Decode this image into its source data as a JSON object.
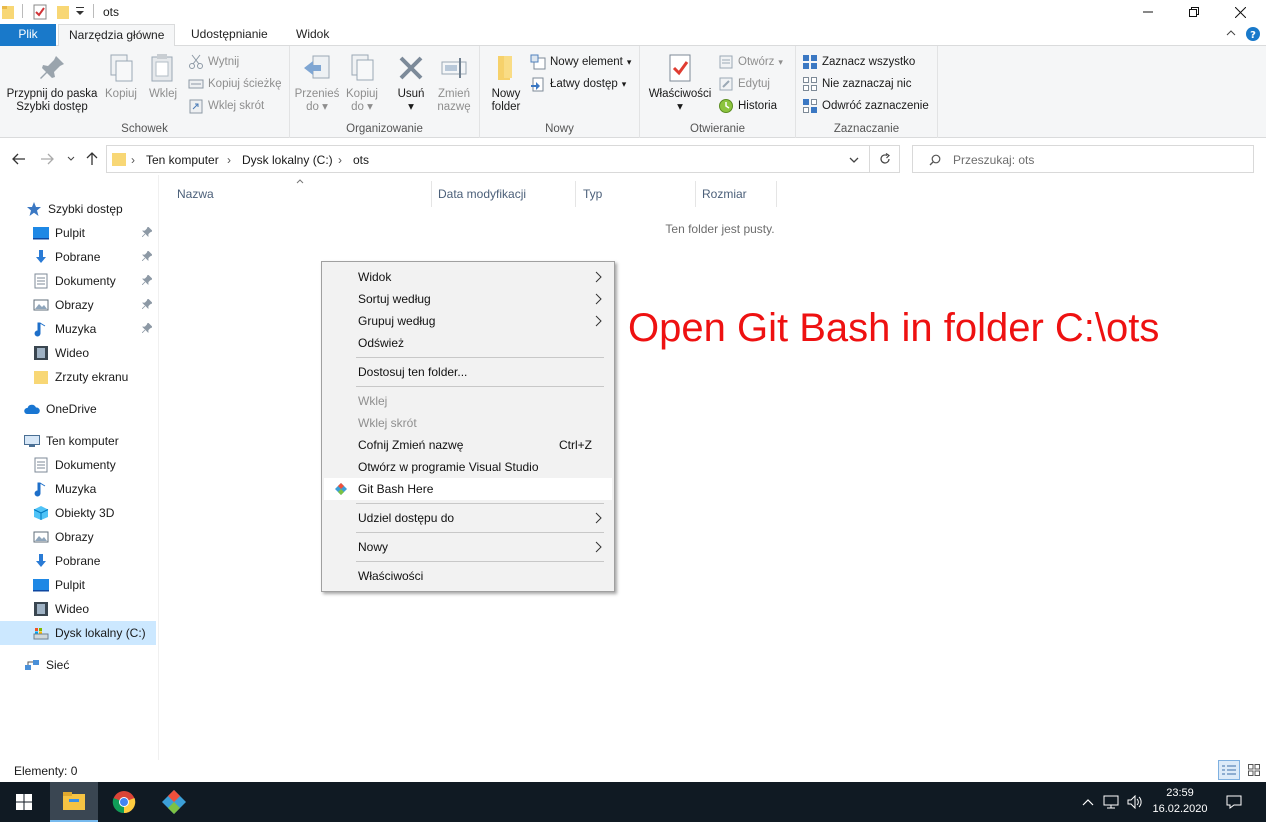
{
  "window": {
    "title": "ots"
  },
  "ribbon_tabs": [
    {
      "label": "Plik"
    },
    {
      "label": "Narzędzia główne"
    },
    {
      "label": "Udostępnianie"
    },
    {
      "label": "Widok"
    }
  ],
  "ribbon": {
    "schowek": {
      "label": "Schowek",
      "pin_line1": "Przypnij do paska",
      "pin_line2": "Szybki dostęp",
      "copy": "Kopiuj",
      "paste": "Wklej",
      "cut": "Wytnij",
      "copy_path": "Kopiuj ścieżkę",
      "paste_shortcut": "Wklej skrót"
    },
    "organizowanie": {
      "label": "Organizowanie",
      "move_line1": "Przenieś",
      "move_line2": "do",
      "copy_line1": "Kopiuj",
      "copy_line2": "do",
      "delete": "Usuń",
      "rename_line1": "Zmień",
      "rename_line2": "nazwę"
    },
    "nowy": {
      "label": "Nowy",
      "folder_line1": "Nowy",
      "folder_line2": "folder",
      "new_item": "Nowy element",
      "easy_access": "Łatwy dostęp"
    },
    "otwieranie": {
      "label": "Otwieranie",
      "properties": "Właściwości",
      "open": "Otwórz",
      "edit": "Edytuj",
      "history": "Historia"
    },
    "zaznaczanie": {
      "label": "Zaznaczanie",
      "select_all": "Zaznacz wszystko",
      "select_none": "Nie zaznaczaj nic",
      "invert": "Odwróć zaznaczenie"
    }
  },
  "address": {
    "crumbs": [
      "Ten komputer",
      "Dysk lokalny (C:)",
      "ots"
    ],
    "search_placeholder": "Przeszukaj: ots"
  },
  "nav": {
    "quick_access": "Szybki dostęp",
    "quick_items": [
      {
        "label": "Pulpit",
        "icon": "desktop-icon",
        "pinned": true
      },
      {
        "label": "Pobrane",
        "icon": "download-icon",
        "pinned": true
      },
      {
        "label": "Dokumenty",
        "icon": "document-icon",
        "pinned": true
      },
      {
        "label": "Obrazy",
        "icon": "pictures-icon",
        "pinned": true
      },
      {
        "label": "Muzyka",
        "icon": "music-icon",
        "pinned": true
      },
      {
        "label": "Wideo",
        "icon": "video-icon",
        "pinned": false
      },
      {
        "label": "Zrzuty ekranu",
        "icon": "folder-icon",
        "pinned": false
      }
    ],
    "onedrive": "OneDrive",
    "this_pc": "Ten komputer",
    "pc_items": [
      {
        "label": "Dokumenty",
        "icon": "document-icon"
      },
      {
        "label": "Muzyka",
        "icon": "music-icon"
      },
      {
        "label": "Obiekty 3D",
        "icon": "3d-objects-icon"
      },
      {
        "label": "Obrazy",
        "icon": "pictures-icon"
      },
      {
        "label": "Pobrane",
        "icon": "download-icon"
      },
      {
        "label": "Pulpit",
        "icon": "desktop-icon"
      },
      {
        "label": "Wideo",
        "icon": "video-icon"
      },
      {
        "label": "Dysk lokalny (C:)",
        "icon": "drive-icon",
        "selected": true
      }
    ],
    "network": "Sieć"
  },
  "content": {
    "columns": [
      "Nazwa",
      "Data modyfikacji",
      "Typ",
      "Rozmiar"
    ],
    "empty_text": "Ten folder jest pusty."
  },
  "context_menu": {
    "items": [
      {
        "label": "Widok",
        "submenu": true
      },
      {
        "label": "Sortuj według",
        "submenu": true
      },
      {
        "label": "Grupuj według",
        "submenu": true
      },
      {
        "label": "Odśwież"
      },
      {
        "label": "Dostosuj ten folder..."
      },
      {
        "label": "Wklej",
        "disabled": true
      },
      {
        "label": "Wklej skrót",
        "disabled": true
      },
      {
        "label": "Cofnij Zmień nazwę",
        "shortcut": "Ctrl+Z"
      },
      {
        "label": "Otwórz w programie Visual Studio"
      },
      {
        "label": "Git Bash Here",
        "highlighted": true
      },
      {
        "label": "Udziel dostępu do",
        "submenu": true
      },
      {
        "label": "Nowy",
        "submenu": true
      },
      {
        "label": "Właściwości"
      }
    ]
  },
  "annotation": "Open Git Bash in folder C:\\ots",
  "status": {
    "items_count": "Elementy: 0"
  },
  "taskbar": {
    "time": "23:59",
    "date": "16.02.2020"
  },
  "colors": {
    "file_tab": "#1979ca",
    "annotation": "#ee1111",
    "taskbar": "#101a23"
  }
}
